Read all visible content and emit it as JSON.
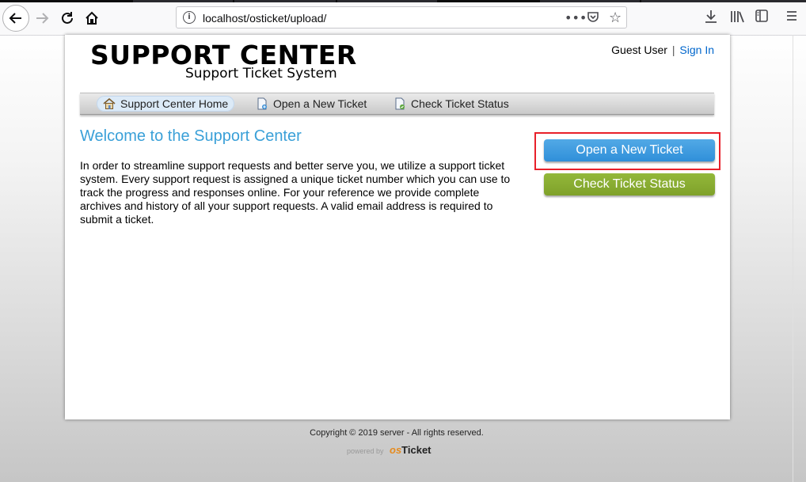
{
  "browser": {
    "url": "localhost/osticket/upload/"
  },
  "header": {
    "logo_title": "SUPPORT CENTER",
    "logo_subtitle": "Support Ticket System",
    "user": "Guest User",
    "separator": "|",
    "sign_in": "Sign In"
  },
  "nav": {
    "items": [
      {
        "label": "Support Center Home",
        "icon": "home-icon"
      },
      {
        "label": "Open a New Ticket",
        "icon": "new-ticket-icon"
      },
      {
        "label": "Check Ticket Status",
        "icon": "ticket-status-icon"
      }
    ]
  },
  "main": {
    "welcome": "Welcome to the Support Center",
    "intro": "In order to streamline support requests and better serve you, we utilize a support ticket system. Every support request is assigned a unique ticket number which you can use to track the progress and responses online. For your reference we provide complete archives and history of all your support requests. A valid email address is required to submit a ticket."
  },
  "actions": {
    "open_ticket": "Open a New Ticket",
    "check_status": "Check Ticket Status"
  },
  "footer": {
    "copyright": "Copyright © 2019 server - All rights reserved.",
    "powered_by": "powered by",
    "brand_os": "os",
    "brand_ticket": "Ticket"
  },
  "colors": {
    "accent_blue": "#3aa0d8",
    "button_green": "#86a92e",
    "highlight_red": "#e8202a"
  }
}
